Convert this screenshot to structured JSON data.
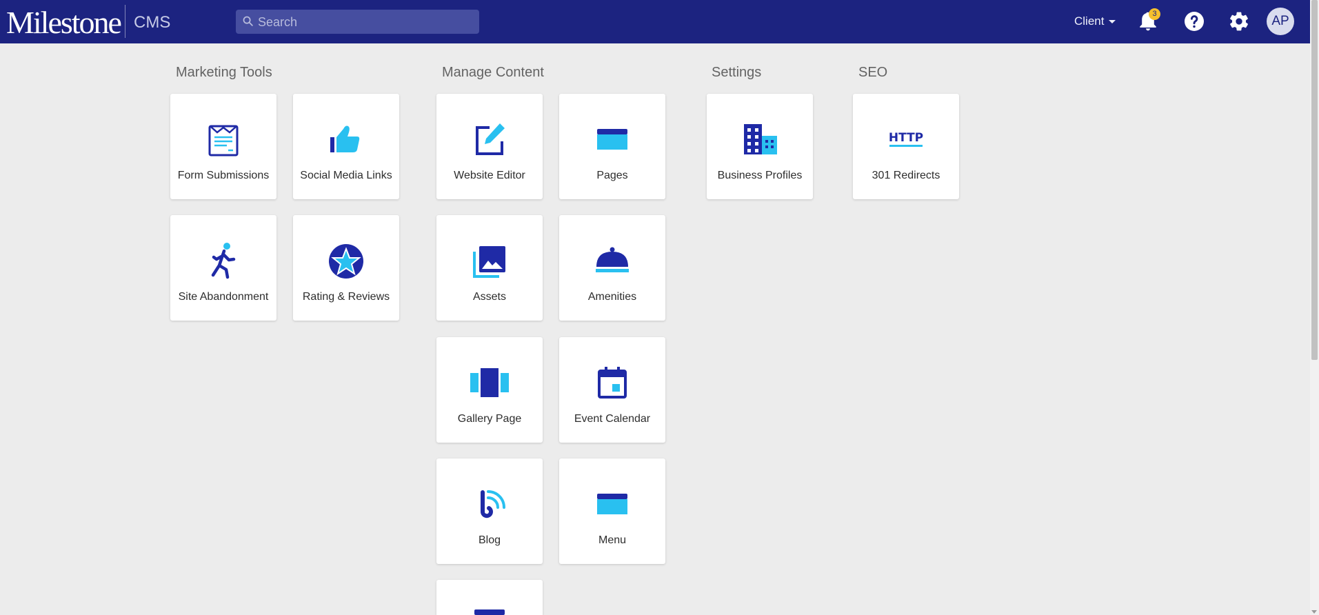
{
  "header": {
    "brand": "Milestone",
    "product": "CMS",
    "search_placeholder": "Search",
    "client_label": "Client",
    "notifications_count": "3",
    "avatar_initials": "AP"
  },
  "sections": {
    "marketing": {
      "title": "Marketing Tools",
      "tiles": [
        {
          "label": "Form Submissions",
          "icon": "form-submissions-icon"
        },
        {
          "label": "Social Media Links",
          "icon": "thumbs-up-icon"
        },
        {
          "label": "Site Abandonment",
          "icon": "running-person-icon"
        },
        {
          "label": "Rating & Reviews",
          "icon": "star-badge-icon"
        }
      ]
    },
    "content": {
      "title": "Manage Content",
      "tiles": [
        {
          "label": "Website Editor",
          "icon": "edit-icon"
        },
        {
          "label": "Pages",
          "icon": "browser-window-icon"
        },
        {
          "label": "Assets",
          "icon": "photo-library-icon"
        },
        {
          "label": "Amenities",
          "icon": "room-service-bell-icon"
        },
        {
          "label": "Gallery Page",
          "icon": "carousel-icon"
        },
        {
          "label": "Event Calendar",
          "icon": "calendar-icon"
        },
        {
          "label": "Blog",
          "icon": "blog-icon"
        },
        {
          "label": "Menu",
          "icon": "browser-window-icon"
        }
      ]
    },
    "settings": {
      "title": "Settings",
      "tiles": [
        {
          "label": "Business Profiles",
          "icon": "building-icon"
        }
      ]
    },
    "seo": {
      "title": "SEO",
      "tiles": [
        {
          "label": "301 Redirects",
          "icon": "http-icon"
        }
      ]
    }
  },
  "colors": {
    "header_bg": "#1c2380",
    "icon_dark": "#1f2aa6",
    "icon_light": "#29c0f0",
    "badge": "#f6c02c",
    "page_bg": "#ececec"
  }
}
